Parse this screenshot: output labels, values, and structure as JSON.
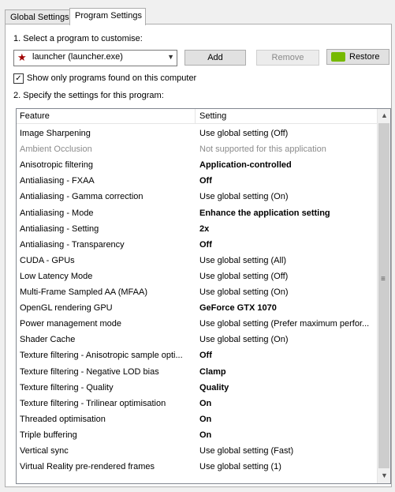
{
  "tabs": [
    {
      "label": "Global Settings"
    },
    {
      "label": "Program Settings"
    }
  ],
  "step1_label": "1. Select a program to customise:",
  "program": {
    "selected": "launcher (launcher.exe)"
  },
  "buttons": {
    "add": "Add",
    "remove": "Remove",
    "restore": "Restore"
  },
  "show_only": {
    "label": "Show only programs found on this computer",
    "checked": true
  },
  "step2_label": "2. Specify the settings for this program:",
  "table": {
    "headers": [
      "Feature",
      "Setting"
    ],
    "rows": [
      {
        "feature": "Image Sharpening",
        "setting": "Use global setting (Off)"
      },
      {
        "feature": "Ambient Occlusion",
        "setting": "Not supported for this application"
      },
      {
        "feature": "Anisotropic filtering",
        "setting": "Application-controlled"
      },
      {
        "feature": "Antialiasing - FXAA",
        "setting": "Off"
      },
      {
        "feature": "Antialiasing - Gamma correction",
        "setting": "Use global setting (On)"
      },
      {
        "feature": "Antialiasing - Mode",
        "setting": "Enhance the application setting"
      },
      {
        "feature": "Antialiasing - Setting",
        "setting": "2x"
      },
      {
        "feature": "Antialiasing - Transparency",
        "setting": "Off"
      },
      {
        "feature": "CUDA - GPUs",
        "setting": "Use global setting (All)"
      },
      {
        "feature": "Low Latency Mode",
        "setting": "Use global setting (Off)"
      },
      {
        "feature": "Multi-Frame Sampled AA (MFAA)",
        "setting": "Use global setting (On)"
      },
      {
        "feature": "OpenGL rendering GPU",
        "setting": "GeForce GTX 1070"
      },
      {
        "feature": "Power management mode",
        "setting": "Use global setting (Prefer maximum perfor..."
      },
      {
        "feature": "Shader Cache",
        "setting": "Use global setting (On)"
      },
      {
        "feature": "Texture filtering - Anisotropic sample opti...",
        "setting": "Off"
      },
      {
        "feature": "Texture filtering - Negative LOD bias",
        "setting": "Clamp"
      },
      {
        "feature": "Texture filtering - Quality",
        "setting": "Quality"
      },
      {
        "feature": "Texture filtering - Trilinear optimisation",
        "setting": "On"
      },
      {
        "feature": "Threaded optimisation",
        "setting": "On"
      },
      {
        "feature": "Triple buffering",
        "setting": "On"
      },
      {
        "feature": "Vertical sync",
        "setting": "Use global setting (Fast)"
      },
      {
        "feature": "Virtual Reality pre-rendered frames",
        "setting": "Use global setting (1)"
      }
    ]
  }
}
